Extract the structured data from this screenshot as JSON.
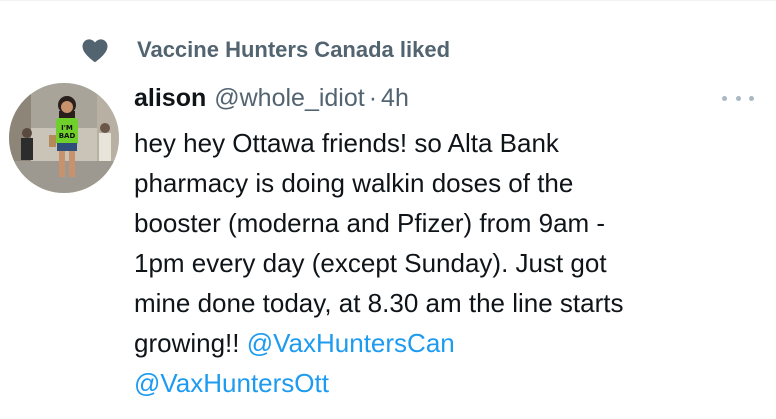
{
  "social_context": {
    "icon": "heart-icon",
    "text": "Vaccine Hunters Canada liked"
  },
  "tweet": {
    "avatar_icon": "avatar",
    "display_name": "alison",
    "handle": "@whole_idiot",
    "separator": "·",
    "time": "4h",
    "more_icon": "more-icon",
    "lines": [
      "hey hey Ottawa friends! so Alta Bank",
      "pharmacy is doing walkin doses of the",
      "booster (moderna and Pfizer) from 9am -",
      "1pm every day (except Sunday). Just got",
      "mine done today, at 8.30 am the line starts"
    ],
    "last_line_text": "growing!! ",
    "mentions": [
      "@VaxHuntersCan",
      "@VaxHuntersOtt"
    ]
  },
  "colors": {
    "text": "#0f1419",
    "secondary": "#536471",
    "link": "#1d9bf0"
  }
}
